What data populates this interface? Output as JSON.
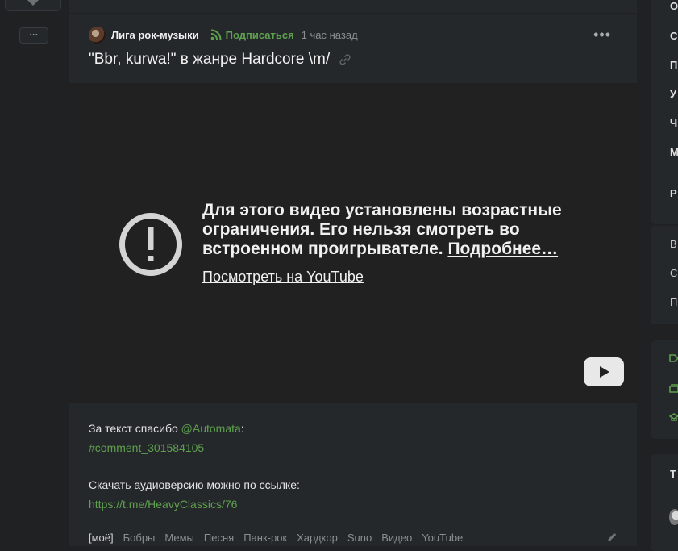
{
  "left_rail": {
    "vote_down_icon": "chevron-down-icon",
    "more_label": "···"
  },
  "post": {
    "community": "Лига рок-музыки",
    "subscribe_label": "Подписаться",
    "time": "1 час назад",
    "menu_label": "•••",
    "title": "\"Bbr, kurwa!\" в жанре Hardcore \\m/",
    "video": {
      "message": "Для этого видео установлены возрастные ограничения. Его нельзя смотреть во встроенном проигрывателе.",
      "more_link": "Подробнее…",
      "watch_link": "Посмотреть на YouTube"
    },
    "thanks_text": "За текст спасибо",
    "thanks_user": "@Automata",
    "thanks_colon": ":",
    "comment_link": "#comment_301584105",
    "download_text": "Скачать аудиоверсию можно по ссылке:",
    "download_link": "https://t.me/HeavyClassics/76",
    "tags": [
      "[моё]",
      "Бобры",
      "Мемы",
      "Песня",
      "Панк-рок",
      "Хардкор",
      "Suno",
      "Видео",
      "YouTube"
    ]
  },
  "right_rail": {
    "panel1_letters": [
      "О",
      "С",
      "П",
      "У",
      "Ч",
      "М",
      "Р"
    ],
    "panel2_letters": [
      "В",
      "С",
      "П"
    ],
    "panel4_letter": "Т"
  },
  "colors": {
    "accent_green": "#5fa04e",
    "page_bg": "#1f2123",
    "card_bg": "#25282b",
    "video_bg": "#212121"
  }
}
